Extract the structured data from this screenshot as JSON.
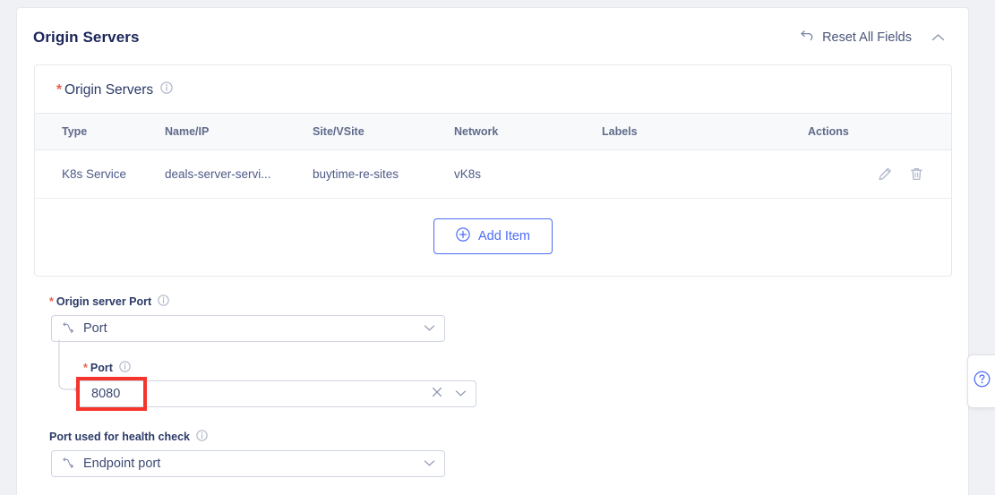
{
  "header": {
    "title": "Origin Servers",
    "reset_label": "Reset All Fields",
    "reset_icon": "undo-arrow-icon",
    "collapse_icon": "chevron-up-icon"
  },
  "origin_servers_panel": {
    "required_marker": "*",
    "title": "Origin Servers",
    "info_icon": "info-icon",
    "table": {
      "columns": [
        "Type",
        "Name/IP",
        "Site/VSite",
        "Network",
        "Labels",
        "Actions"
      ],
      "rows": [
        {
          "type": "K8s Service",
          "name_ip": "deals-server-servi...",
          "site_vsite": "buytime-re-sites",
          "network": "vK8s",
          "labels": "",
          "actions": [
            "edit-icon",
            "delete-icon"
          ]
        }
      ]
    },
    "add_item_label": "Add Item",
    "add_item_icon": "plus-circle-icon"
  },
  "origin_server_port": {
    "required_marker": "*",
    "label": "Origin server Port",
    "info_icon": "info-icon",
    "select_value": "Port",
    "select_left_icon": "branch-icon",
    "select_chevron": "chevron-down-icon"
  },
  "nested_port": {
    "required_marker": "*",
    "label": "Port",
    "info_icon": "info-icon",
    "value": "8080",
    "clear_icon": "clear-x-icon",
    "chevron": "chevron-down-icon"
  },
  "health_check_port": {
    "label": "Port used for health check",
    "info_icon": "info-icon",
    "select_value": "Endpoint port",
    "select_left_icon": "branch-icon",
    "select_chevron": "chevron-down-icon"
  },
  "help_button": {
    "icon": "question-circle-icon"
  },
  "colors": {
    "accent_blue": "#4d6cf5",
    "title_navy": "#1b2559",
    "required_red": "#e8604c",
    "annotation_red": "#f5352b",
    "border_gray": "#e6e8ec",
    "page_bg": "#f0f1f4"
  }
}
